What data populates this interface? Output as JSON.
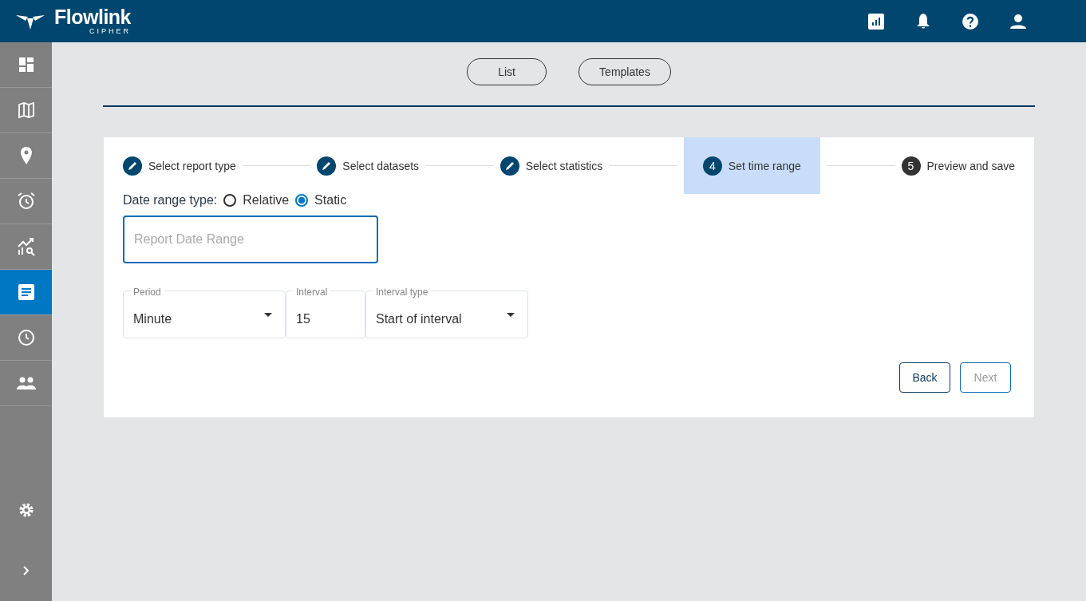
{
  "header": {
    "brand": "Flowlink",
    "sub_brand": "CIPHER",
    "actions": [
      {
        "kind": "report"
      },
      {
        "kind": "bell"
      },
      {
        "kind": "help"
      },
      {
        "kind": "user"
      }
    ]
  },
  "sidebar": {
    "items": [
      {
        "kind": "dashboard",
        "selected": false
      },
      {
        "kind": "map",
        "selected": false
      },
      {
        "kind": "pin",
        "selected": false
      },
      {
        "kind": "alarm",
        "selected": false
      },
      {
        "kind": "analytics",
        "selected": false
      },
      {
        "kind": "report",
        "selected": true
      },
      {
        "kind": "clock",
        "selected": false
      },
      {
        "kind": "users",
        "selected": false
      }
    ],
    "bottom": [
      {
        "kind": "settings"
      },
      {
        "kind": "expand"
      }
    ]
  },
  "view_tabs": [
    {
      "label": "List"
    },
    {
      "label": "Templates"
    }
  ],
  "stepper": [
    {
      "label": "Select report type",
      "kind": "done",
      "selected": false
    },
    {
      "label": "Select datasets",
      "kind": "done",
      "selected": false
    },
    {
      "label": "Select statistics",
      "kind": "done",
      "selected": false
    },
    {
      "label": "Set time range",
      "number": "4",
      "kind": "number",
      "selected": true
    },
    {
      "label": "Preview and save",
      "number": "5",
      "kind": "number",
      "selected": false
    }
  ],
  "date_range_type": {
    "label": "Date range type:",
    "options": [
      {
        "label": "Relative",
        "selected": false
      },
      {
        "label": "Static",
        "selected": true
      }
    ]
  },
  "date_range_field": {
    "placeholder": "Report Date Range",
    "focused": true
  },
  "fields": [
    {
      "label": "Period",
      "value": "Minute",
      "kind": "select"
    },
    {
      "label": "Interval",
      "value": "15",
      "kind": "input"
    },
    {
      "label": "Interval type",
      "value": "Start of interval",
      "kind": "select"
    }
  ],
  "buttons": [
    {
      "label": "Back",
      "disabled": false
    },
    {
      "label": "Next",
      "disabled": true
    }
  ]
}
